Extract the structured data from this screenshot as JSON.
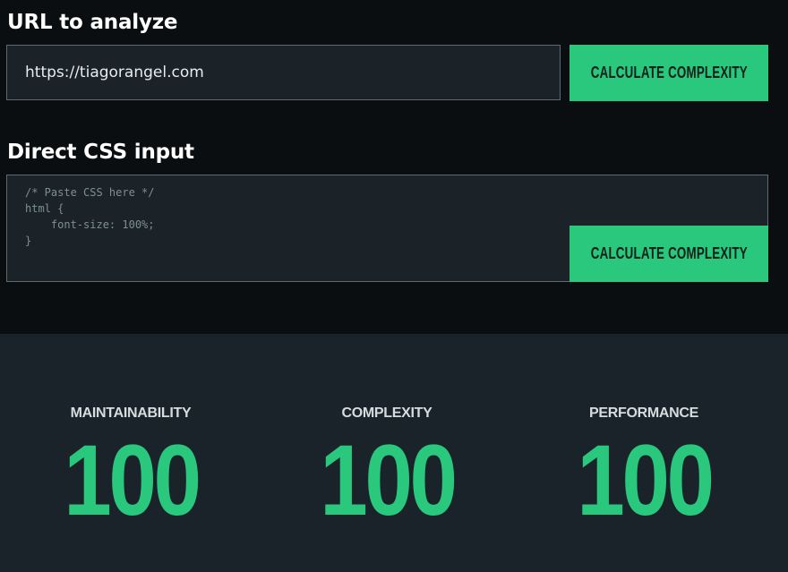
{
  "url_section": {
    "heading": "URL to analyze",
    "input_value": "https://tiagorangel.com",
    "button_label": "Calculate complexity"
  },
  "css_section": {
    "heading": "Direct CSS input",
    "input_value": "/* Paste CSS here */\nhtml {\n    font-size: 100%;\n}",
    "button_label": "Calculate complexity"
  },
  "results": [
    {
      "label": "MAINTAINABILITY",
      "value": "100"
    },
    {
      "label": "COMPLEXITY",
      "value": "100"
    },
    {
      "label": "PERFORMANCE",
      "value": "100"
    }
  ],
  "colors": {
    "background": "#0a0e11",
    "panel": "#1a2329",
    "accent": "#2ac87d",
    "input_border": "#5b6b72"
  }
}
